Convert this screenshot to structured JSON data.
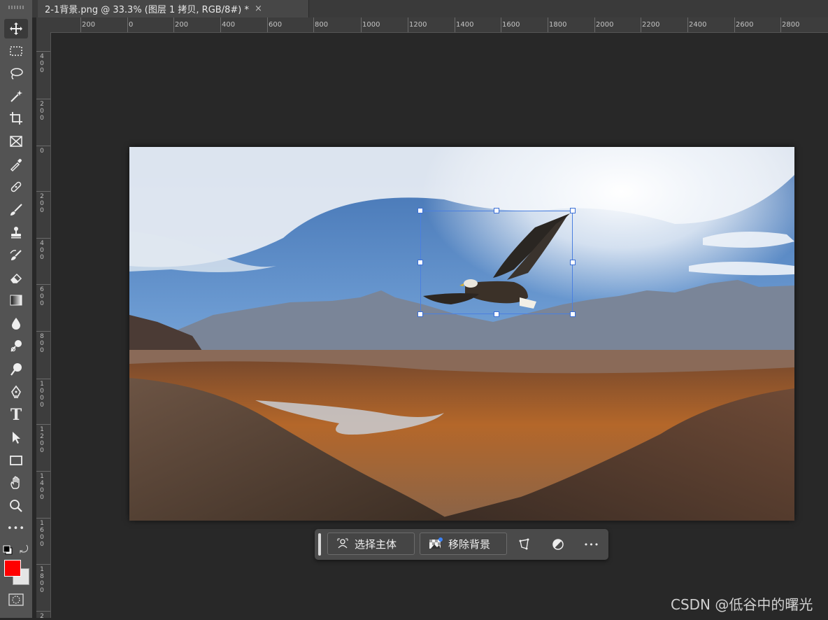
{
  "document": {
    "tab_title": "2-1背景.png @ 33.3% (图层 1 拷贝, RGB/8#) *",
    "close_glyph": "×"
  },
  "ruler": {
    "horizontal_labels": [
      "200",
      "0",
      "200",
      "400",
      "600",
      "800",
      "1000",
      "1200",
      "1400",
      "1600",
      "1800",
      "2000",
      "2200",
      "2400",
      "2600",
      "2800"
    ],
    "vertical_labels": [
      [
        "4",
        "0",
        "0"
      ],
      [
        "2",
        "0",
        "0"
      ],
      [
        "0"
      ],
      [
        "2",
        "0",
        "0"
      ],
      [
        "4",
        "0",
        "0"
      ],
      [
        "6",
        "0",
        "0"
      ],
      [
        "8",
        "0",
        "0"
      ],
      [
        "1",
        "0",
        "0",
        "0"
      ],
      [
        "1",
        "2",
        "0",
        "0"
      ],
      [
        "1",
        "4",
        "0",
        "0"
      ],
      [
        "1",
        "6",
        "0",
        "0"
      ],
      [
        "1",
        "8",
        "0",
        "0"
      ],
      [
        "2"
      ]
    ]
  },
  "toolbar": {
    "tools": [
      "move-tool",
      "rectangular-marquee-tool",
      "lasso-tool",
      "magic-wand-tool",
      "crop-tool",
      "frame-tool",
      "eyedropper-tool",
      "spot-healing-tool",
      "brush-tool",
      "clone-stamp-tool",
      "history-brush-tool",
      "eraser-tool",
      "gradient-tool",
      "blur-tool",
      "dodge-tool",
      "sponge-tool",
      "pen-tool",
      "type-tool",
      "path-selection-tool",
      "rectangle-tool",
      "hand-tool",
      "zoom-tool",
      "more-tools"
    ],
    "type_glyph": "T",
    "more_glyph": "•••",
    "swap_glyph": "⤾",
    "foreground_color": "#ff0000",
    "background_color": "#e5e5e5"
  },
  "context_bar": {
    "select_subject_label": "选择主体",
    "remove_background_label": "移除背景",
    "more_glyph": "•••"
  },
  "watermark": "CSDN @低谷中的曙光"
}
